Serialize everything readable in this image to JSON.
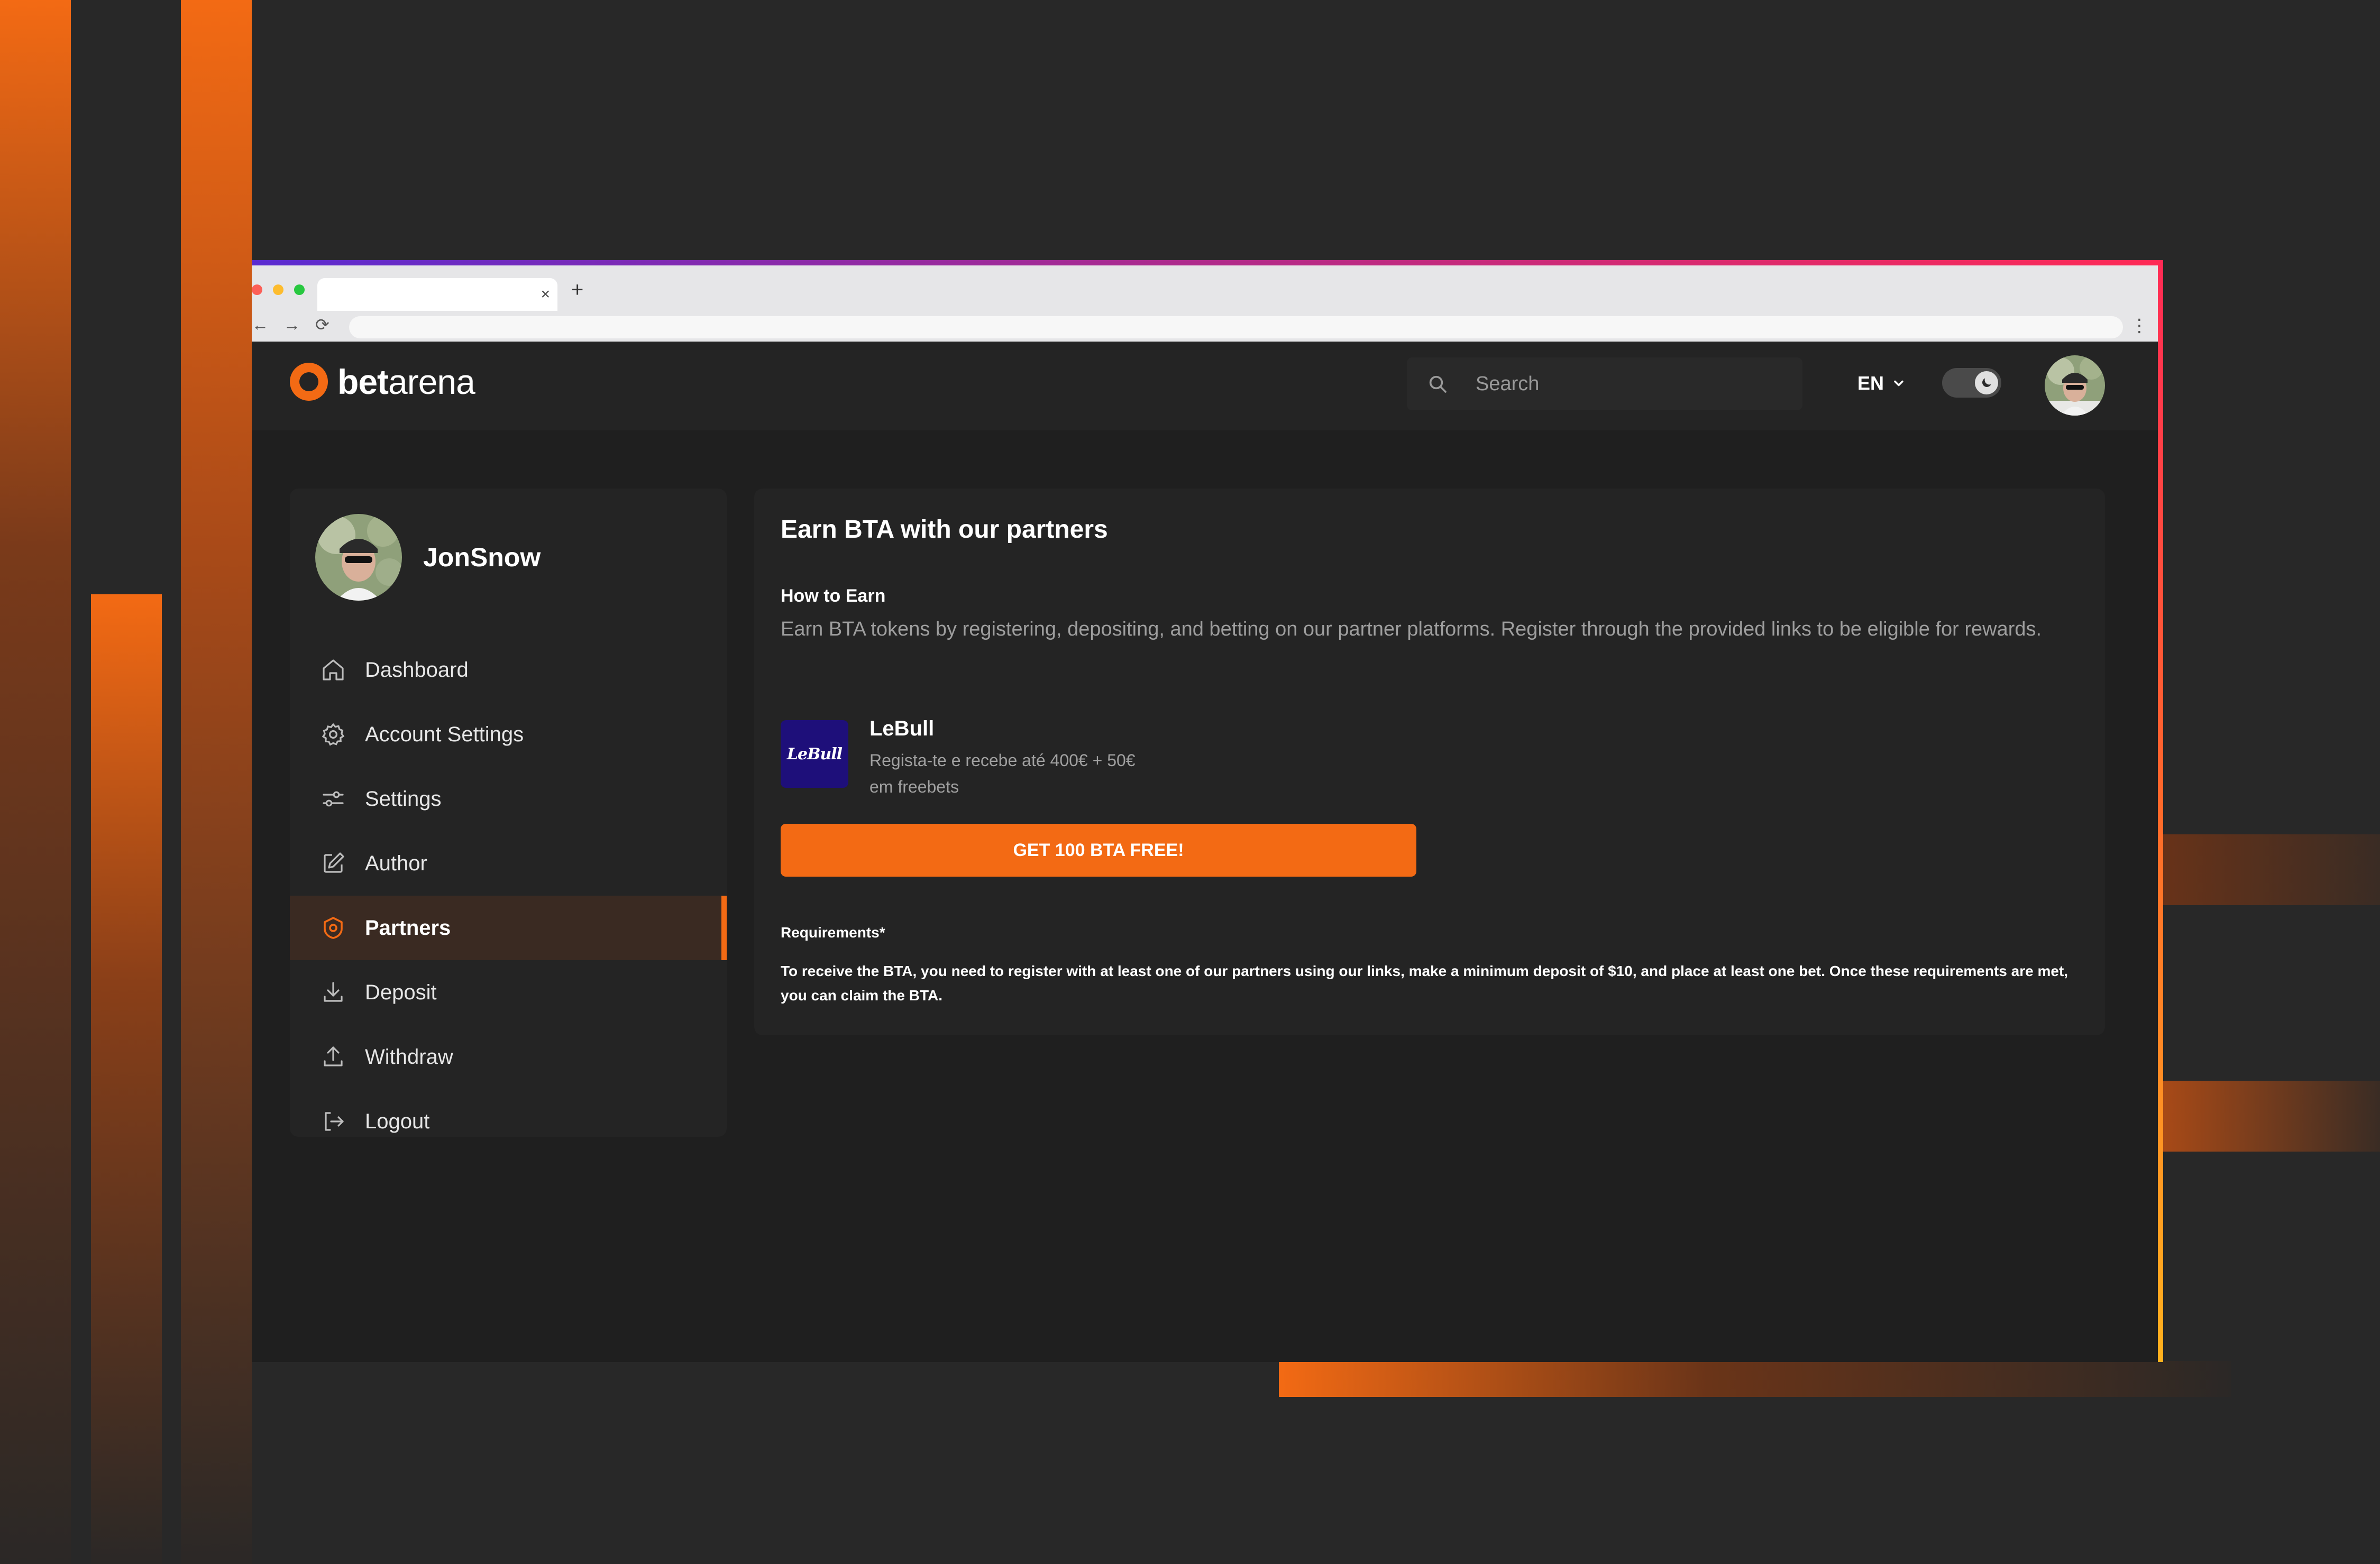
{
  "browser": {
    "tab_close": "×",
    "new_tab": "+",
    "nav": {
      "back": "←",
      "forward": "→",
      "reload": "⟳"
    },
    "menu": "⋮"
  },
  "header": {
    "logo": {
      "part1": "bet",
      "part2": "arena"
    },
    "search": {
      "placeholder": "Search",
      "icon": "search-icon"
    },
    "language": "EN",
    "theme_toggle": {
      "state": "dark",
      "icon": "moon-icon"
    }
  },
  "sidebar": {
    "username": "JonSnow",
    "items": [
      {
        "label": "Dashboard",
        "icon": "home-icon",
        "active": false
      },
      {
        "label": "Account Settings",
        "icon": "gear-icon",
        "active": false
      },
      {
        "label": "Settings",
        "icon": "sliders-icon",
        "active": false
      },
      {
        "label": "Author",
        "icon": "edit-icon",
        "active": false
      },
      {
        "label": "Partners",
        "icon": "shield-icon",
        "active": true
      },
      {
        "label": "Deposit",
        "icon": "download-icon",
        "active": false
      },
      {
        "label": "Withdraw",
        "icon": "upload-icon",
        "active": false
      },
      {
        "label": "Logout",
        "icon": "logout-icon",
        "active": false
      }
    ]
  },
  "main": {
    "title": "Earn BTA with our partners",
    "how_title": "How to Earn",
    "how_text": "Earn BTA tokens by registering, depositing, and betting on our partner platforms. Register through the provided links to be eligible for rewards.",
    "partner": {
      "logo_text": "LeBull",
      "name": "LeBull",
      "description": "Regista-te e recebe até 400€ + 50€ em freebets"
    },
    "cta_label": "GET 100 BTA FREE!",
    "requirements_label": "Requirements*",
    "requirements_text": "To receive the BTA, you need to register with at least one of our partners using our links, make a minimum deposit of $10, and place at least one bet. Once these requirements are met, you can claim the BTA."
  },
  "colors": {
    "accent": "#f36a14",
    "background": "#282828",
    "panel": "#242424",
    "active_item": "#3a2a22"
  }
}
